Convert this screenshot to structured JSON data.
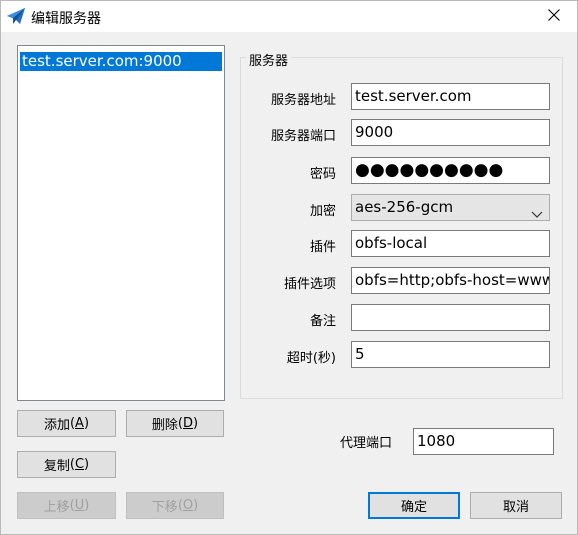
{
  "window": {
    "title": "编辑服务器",
    "icon": "paper-plane-icon",
    "close_icon": "close-icon"
  },
  "server_list": {
    "items": [
      {
        "label": "test.server.com:9000",
        "selected": true
      }
    ]
  },
  "list_buttons": {
    "add": {
      "label": "添加",
      "hotkey": "A"
    },
    "delete": {
      "label": "删除",
      "hotkey": "D"
    },
    "copy": {
      "label": "复制",
      "hotkey": "C"
    },
    "move_up": {
      "label": "上移",
      "hotkey": "U",
      "disabled": true
    },
    "move_down": {
      "label": "下移",
      "hotkey": "O",
      "disabled": true
    }
  },
  "server_group": {
    "title": "服务器",
    "fields": {
      "address": {
        "label": "服务器地址",
        "value": "test.server.com"
      },
      "port": {
        "label": "服务器端口",
        "value": "9000"
      },
      "password": {
        "label": "密码",
        "value": "●●●●●●●●●●"
      },
      "encryption": {
        "label": "加密",
        "value": "aes-256-gcm"
      },
      "plugin": {
        "label": "插件",
        "value": "obfs-local"
      },
      "plugin_options": {
        "label": "插件选项",
        "value": "obfs=http;obfs-host=www"
      },
      "remarks": {
        "label": "备注",
        "value": ""
      },
      "timeout": {
        "label": "超时(秒)",
        "value": "5"
      }
    }
  },
  "proxy": {
    "label": "代理端口",
    "value": "1080"
  },
  "dialog_buttons": {
    "ok": "确定",
    "cancel": "取消"
  },
  "colors": {
    "selection": "#0078d7",
    "app_icon": "#1f6fc4"
  }
}
